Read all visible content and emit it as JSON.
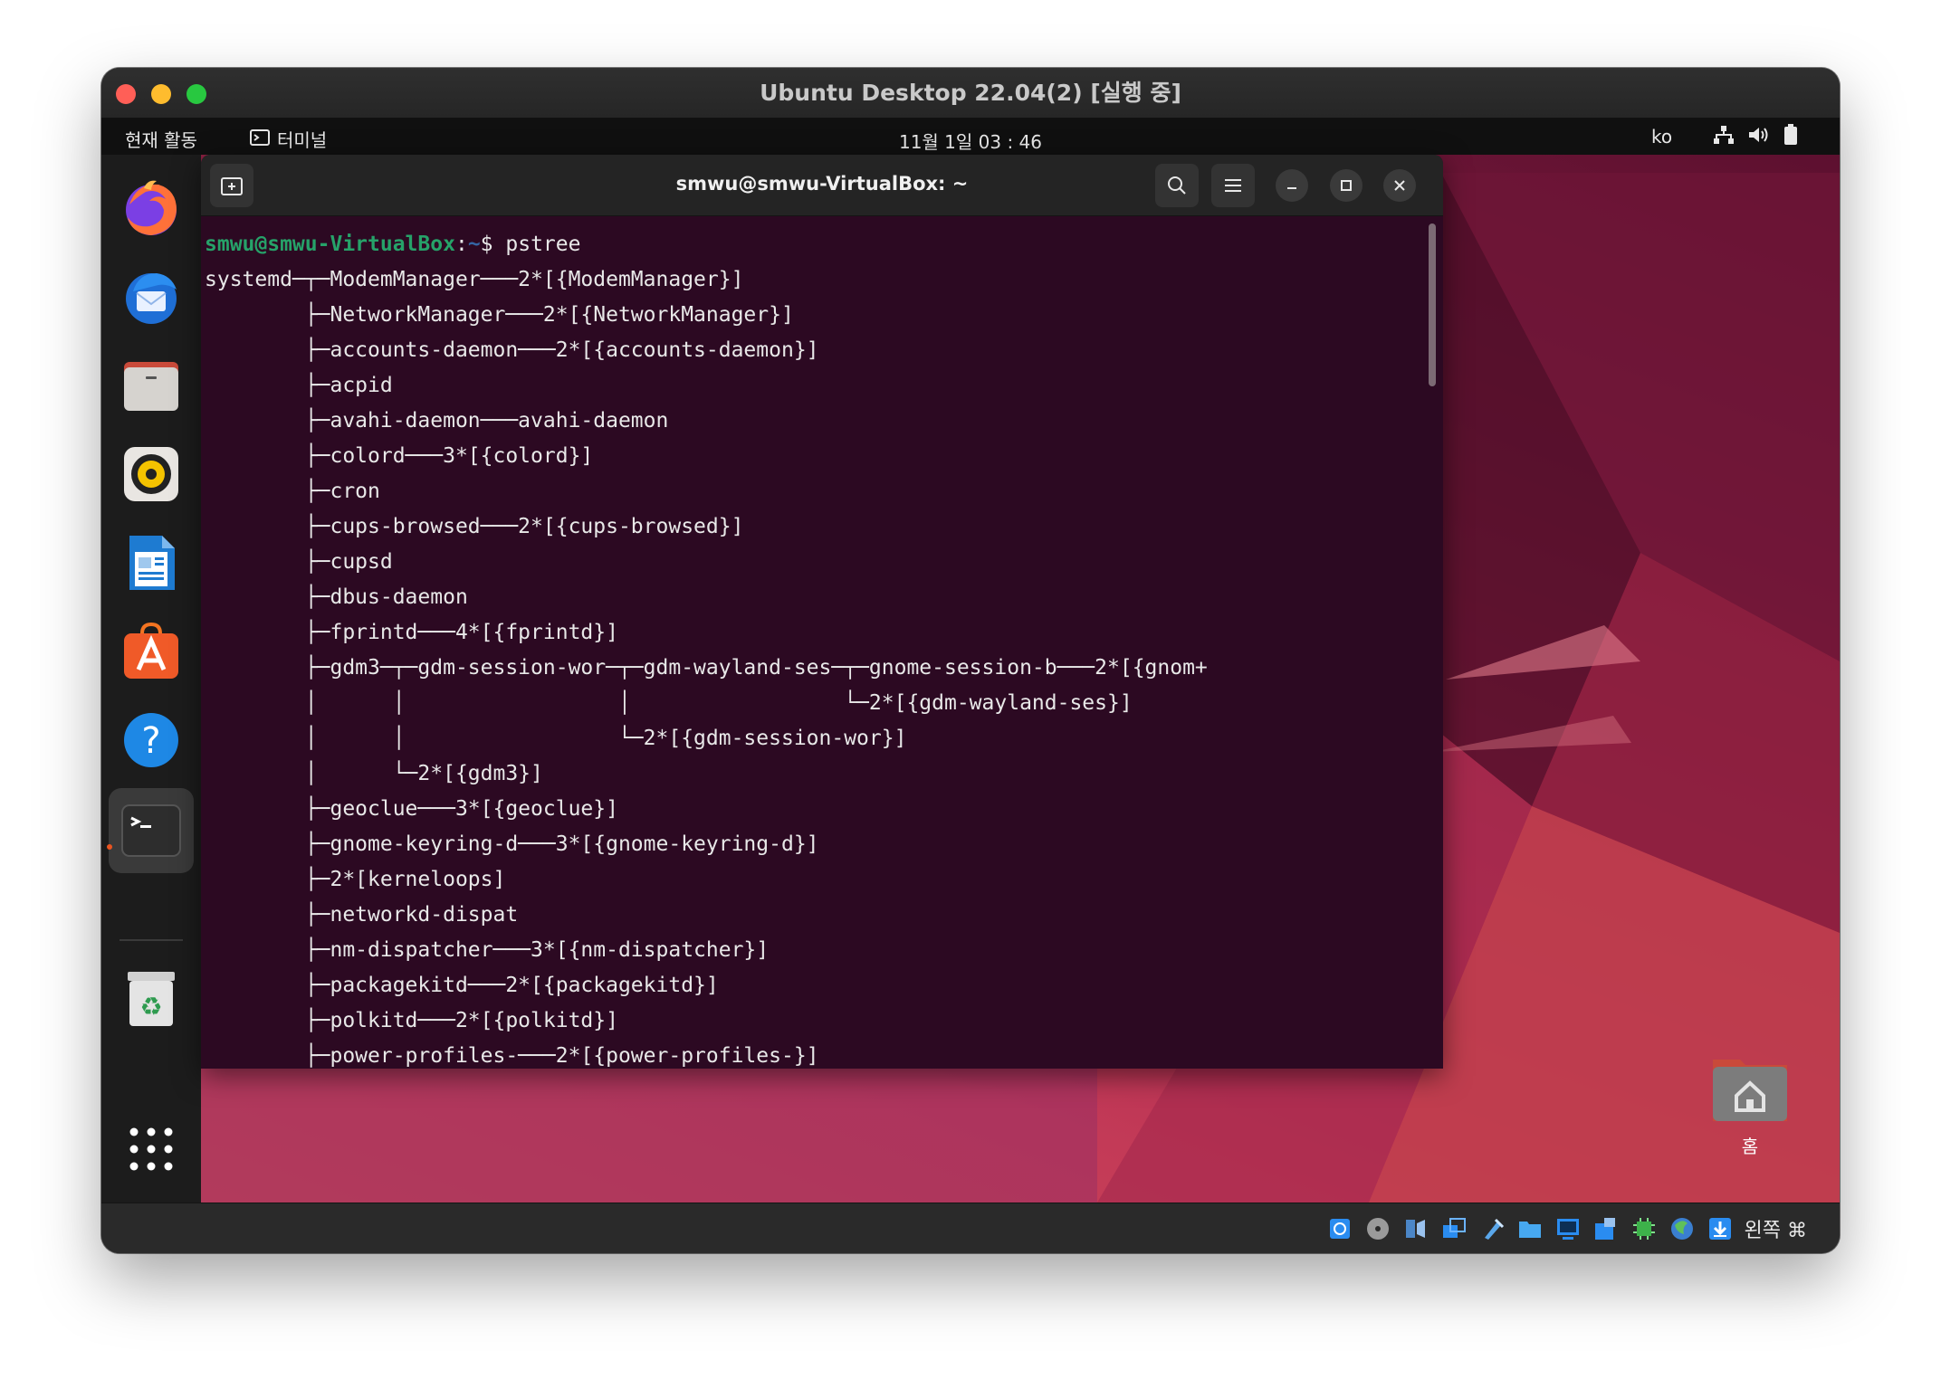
{
  "window": {
    "title": "Ubuntu Desktop 22.04(2) [실행 중]"
  },
  "topbar": {
    "activities": "현재 활동",
    "app_name": "터미널",
    "clock": "11월 1일 03 : 46",
    "lang": "ko",
    "tray_icons": [
      "network-icon",
      "volume-icon",
      "battery-icon"
    ]
  },
  "dock": {
    "items": [
      "firefox-icon",
      "thunderbird-icon",
      "files-icon",
      "rhythmbox-icon",
      "writer-icon",
      "software-icon",
      "help-icon",
      "terminal-icon",
      "trash-icon",
      "app-grid-icon"
    ],
    "active": "terminal-icon"
  },
  "terminal": {
    "title": "smwu@smwu-VirtualBox: ~",
    "prompt_user": "smwu@smwu-VirtualBox",
    "prompt_sep": ":",
    "prompt_path": "~",
    "prompt_symbol": "$ ",
    "command": "pstree",
    "output": [
      "systemd─┬─ModemManager───2*[{ModemManager}]",
      "        ├─NetworkManager───2*[{NetworkManager}]",
      "        ├─accounts-daemon───2*[{accounts-daemon}]",
      "        ├─acpid",
      "        ├─avahi-daemon───avahi-daemon",
      "        ├─colord───3*[{colord}]",
      "        ├─cron",
      "        ├─cups-browsed───2*[{cups-browsed}]",
      "        ├─cupsd",
      "        ├─dbus-daemon",
      "        ├─fprintd───4*[{fprintd}]",
      "        ├─gdm3─┬─gdm-session-wor─┬─gdm-wayland-ses─┬─gnome-session-b───2*[{gnom+",
      "        │      │                 │                 └─2*[{gdm-wayland-ses}]",
      "        │      │                 └─2*[{gdm-session-wor}]",
      "        │      └─2*[{gdm3}]",
      "        ├─geoclue───3*[{geoclue}]",
      "        ├─gnome-keyring-d───3*[{gnome-keyring-d}]",
      "        ├─2*[kerneloops]",
      "        ├─networkd-dispat",
      "        ├─nm-dispatcher───3*[{nm-dispatcher}]",
      "        ├─packagekitd───2*[{packagekitd}]",
      "        ├─polkitd───2*[{polkitd}]",
      "        ├─power-profiles-───2*[{power-profiles-}]"
    ]
  },
  "desktop": {
    "home_label": "홈"
  },
  "vbox": {
    "host_key": "왼쪽 ⌘",
    "icons": [
      "hard-disk-icon",
      "optical-drive-icon",
      "audio-icon",
      "network-adapter-icon",
      "usb-icon",
      "shared-folder-icon",
      "display-icon",
      "recording-icon",
      "cpu-icon",
      "mouse-integration-icon",
      "keyboard-capture-icon"
    ]
  },
  "colors": {
    "terminal_bg": "#2c0922",
    "prompt_user": "#26a269",
    "prompt_path": "#3465a4",
    "accent": "#e95420"
  }
}
